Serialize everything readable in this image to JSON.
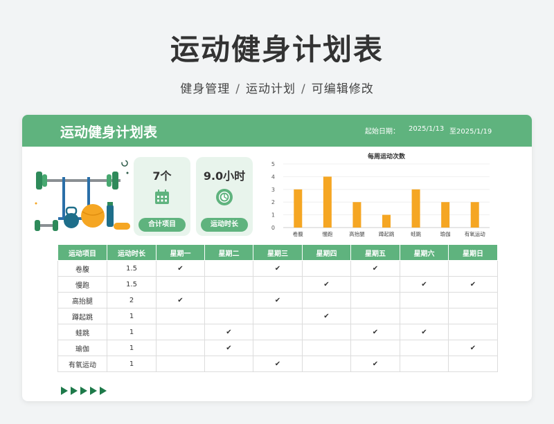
{
  "header": {
    "title": "运动健身计划表",
    "subtitle": [
      "健身管理",
      "运动计划",
      "可编辑修改"
    ],
    "separator": "/"
  },
  "banner": {
    "title": "运动健身计划表",
    "date_label": "起始日期：",
    "start_date": "2025/1/13",
    "end_date": "至2025/1/19"
  },
  "stats": [
    {
      "value": "7个",
      "label": "合计项目",
      "icon": "calendar-icon"
    },
    {
      "value": "9.0小时",
      "label": "运动时长",
      "icon": "timer-icon"
    }
  ],
  "chart_data": {
    "type": "bar",
    "title": "每周运动次数",
    "categories": [
      "卷腹",
      "慢跑",
      "高抬腿",
      "蹲起跳",
      "蛙跳",
      "瑜伽",
      "有氧运动"
    ],
    "values": [
      3,
      4,
      2,
      1,
      3,
      2,
      2
    ],
    "ylim": [
      0,
      5
    ],
    "yticks": [
      "0",
      "1",
      "2",
      "3",
      "4",
      "5"
    ],
    "grid": true,
    "bar_color": "#f5a623"
  },
  "table": {
    "headers": [
      "运动项目",
      "运动时长",
      "星期一",
      "星期二",
      "星期三",
      "星期四",
      "星期五",
      "星期六",
      "星期日"
    ],
    "check": "✔",
    "rows": [
      {
        "name": "卷腹",
        "duration": "1.5",
        "days": [
          true,
          false,
          true,
          false,
          true,
          false,
          false
        ]
      },
      {
        "name": "慢跑",
        "duration": "1.5",
        "days": [
          false,
          false,
          false,
          true,
          false,
          true,
          true
        ]
      },
      {
        "name": "高抬腿",
        "duration": "2",
        "days": [
          true,
          false,
          true,
          false,
          false,
          false,
          false
        ]
      },
      {
        "name": "蹲起跳",
        "duration": "1",
        "days": [
          false,
          false,
          false,
          true,
          false,
          false,
          false
        ]
      },
      {
        "name": "蛙跳",
        "duration": "1",
        "days": [
          false,
          true,
          false,
          false,
          true,
          true,
          false
        ]
      },
      {
        "name": "瑜伽",
        "duration": "1",
        "days": [
          false,
          true,
          false,
          false,
          false,
          false,
          true
        ]
      },
      {
        "name": "有氧运动",
        "duration": "1",
        "days": [
          false,
          false,
          true,
          false,
          true,
          false,
          false
        ]
      }
    ]
  },
  "colors": {
    "accent": "#5fb37e",
    "accent_light": "#e8f4ec",
    "bar": "#f5a623",
    "arrow": "#1e7a4a"
  }
}
